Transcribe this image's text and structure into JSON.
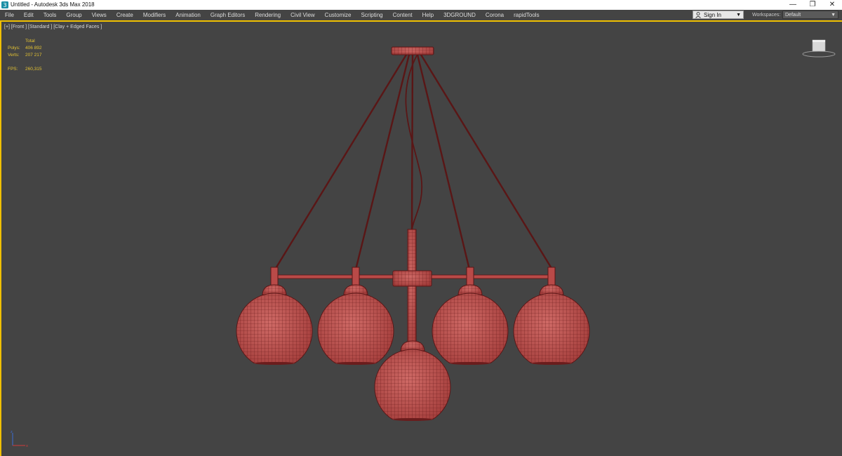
{
  "window": {
    "title": "Untitled - Autodesk 3ds Max 2018",
    "minimize": "—",
    "restore": "❐",
    "close": "✕"
  },
  "menu": [
    "File",
    "Edit",
    "Tools",
    "Group",
    "Views",
    "Create",
    "Modifiers",
    "Animation",
    "Graph Editors",
    "Rendering",
    "Civil View",
    "Customize",
    "Scripting",
    "Content",
    "Help",
    "3DGROUND",
    "Corona",
    "rapidTools"
  ],
  "signin": {
    "label": "Sign In",
    "icon": "user-icon"
  },
  "workspaces": {
    "label": "Workspaces:",
    "value": "Default"
  },
  "viewport": {
    "label": "[+] [Front ] [Standard ] [Clay + Edged Faces ]",
    "stats": {
      "header": "Total",
      "polys_label": "Polys:",
      "polys_value": "406 892",
      "verts_label": "Verts:",
      "verts_value": "207 217",
      "fps_label": "FPS:",
      "fps_value": "260,315"
    }
  },
  "colors": {
    "viewport_bg": "#444444",
    "active_border": "#f0c000",
    "stats_text": "#e3c232",
    "model_fill": "#b94a48",
    "wire": "#5a1616"
  }
}
